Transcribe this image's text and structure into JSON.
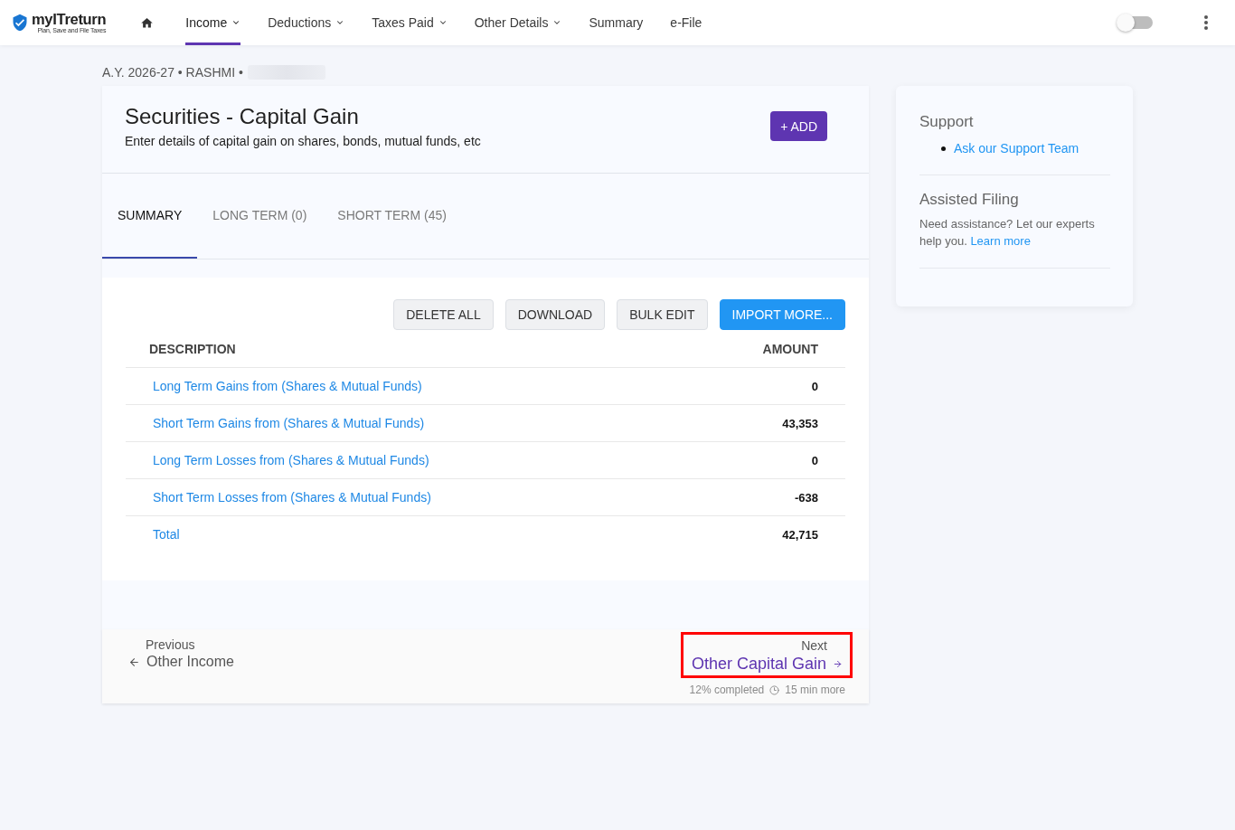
{
  "header": {
    "logo": {
      "name": "myITreturn",
      "tagline": "Plan, Save and File Taxes"
    },
    "nav": [
      {
        "label": "Income",
        "has_menu": true,
        "selected": true
      },
      {
        "label": "Deductions",
        "has_menu": true,
        "selected": false
      },
      {
        "label": "Taxes Paid",
        "has_menu": true,
        "selected": false
      },
      {
        "label": "Other Details",
        "has_menu": true,
        "selected": false
      },
      {
        "label": "Summary",
        "has_menu": false,
        "selected": false
      },
      {
        "label": "e-File",
        "has_menu": false,
        "selected": false
      }
    ],
    "theme_toggle": {
      "on": false
    }
  },
  "breadcrumb": "A.Y. 2026-27 • RASHMI •",
  "page": {
    "title": "Securities - Capital Gain",
    "subtitle": "Enter details of capital gain on shares, bonds, mutual funds, etc",
    "add_button": "+ ADD"
  },
  "tabs": [
    {
      "label": "SUMMARY",
      "selected": true
    },
    {
      "label": "LONG TERM (0)",
      "selected": false
    },
    {
      "label": "SHORT TERM (45)",
      "selected": false
    }
  ],
  "actions": [
    {
      "label": "DELETE ALL",
      "kind": "secondary"
    },
    {
      "label": "DOWNLOAD",
      "kind": "secondary"
    },
    {
      "label": "BULK EDIT",
      "kind": "secondary"
    },
    {
      "label": "IMPORT MORE...",
      "kind": "primary"
    }
  ],
  "table": {
    "columns": [
      "DESCRIPTION",
      "AMOUNT"
    ],
    "rows": [
      {
        "description": "Long Term Gains from (Shares & Mutual Funds)",
        "amount": "0"
      },
      {
        "description": "Short Term Gains from (Shares & Mutual Funds)",
        "amount": "43,353"
      },
      {
        "description": "Long Term Losses from (Shares & Mutual Funds)",
        "amount": "0"
      },
      {
        "description": "Short Term Losses from (Shares & Mutual Funds)",
        "amount": "-638"
      },
      {
        "description": "Total",
        "amount": "42,715"
      }
    ]
  },
  "navigation": {
    "previous": {
      "caption": "Previous",
      "label": "Other Income"
    },
    "next": {
      "caption": "Next",
      "label": "Other Capital Gain",
      "highlighted": true
    },
    "progress": {
      "completed": "12% completed",
      "remaining": "15 min more"
    }
  },
  "sidebar": {
    "support": {
      "title": "Support",
      "links": [
        "Ask our Support Team"
      ]
    },
    "assisted": {
      "title": "Assisted Filing",
      "text": "Need assistance? Let our experts help you.",
      "link": "Learn more"
    }
  }
}
